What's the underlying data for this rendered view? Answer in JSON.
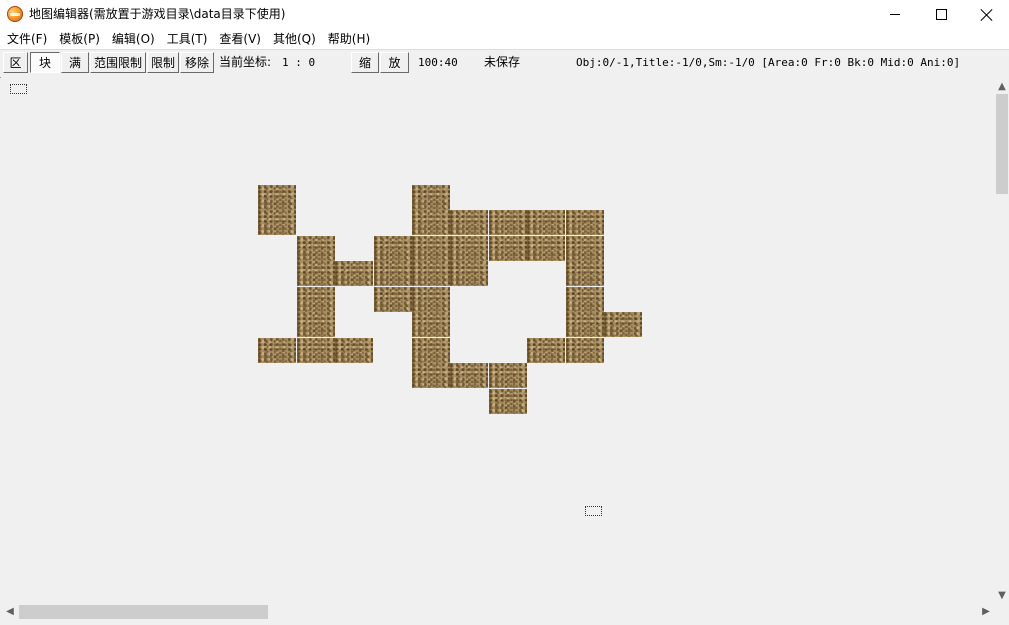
{
  "window": {
    "title": "地图编辑器(需放置于游戏目录\\data目录下使用)",
    "minimize_icon": "minimize-icon",
    "maximize_icon": "maximize-icon",
    "close_icon": "close-icon"
  },
  "menu": {
    "items": [
      "文件(F)",
      "模板(P)",
      "编辑(O)",
      "工具(T)",
      "查看(V)",
      "其他(Q)",
      "帮助(H)"
    ]
  },
  "toolbar": {
    "btn_area": "区",
    "btn_block": "块",
    "btn_full": "满",
    "btn_range_limit": "范围限制",
    "btn_limit": "限制",
    "btn_remove": "移除",
    "coord_label": "当前坐标:",
    "coord_value": "1 : 0",
    "btn_shrink": "缩",
    "btn_enlarge": "放",
    "map_size": "100:40",
    "save_status": "未保存",
    "stats": "Obj:0/-1,Title:-1/0,Sm:-1/0 [Area:0 Fr:0 Bk:0 Mid:0 Ani:0]"
  },
  "map": {
    "tile_texture": "sand",
    "tile_color": "#a88d5e",
    "tile_count": 40
  },
  "scrollbars": {
    "up_arrow": "▲",
    "down_arrow": "▼",
    "left_arrow": "◀",
    "right_arrow": "▶"
  }
}
